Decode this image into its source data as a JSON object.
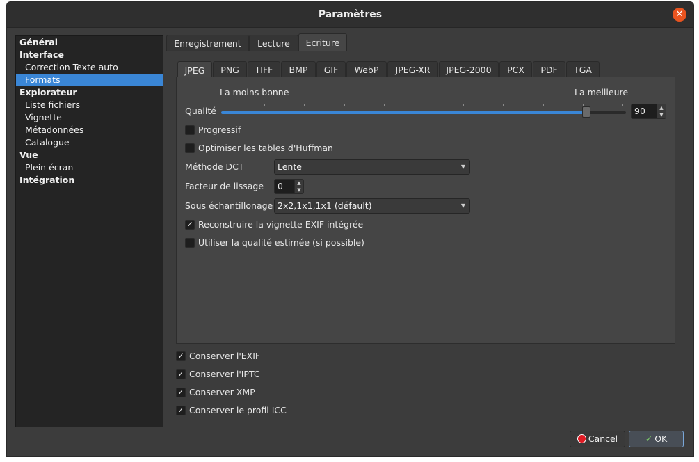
{
  "window": {
    "title": "Paramètres"
  },
  "sidebar": {
    "items": [
      {
        "label": "Général",
        "type": "cat"
      },
      {
        "label": "Interface",
        "type": "cat"
      },
      {
        "label": "Correction Texte auto",
        "type": "sub"
      },
      {
        "label": "Formats",
        "type": "sub",
        "selected": true
      },
      {
        "label": "Explorateur",
        "type": "cat"
      },
      {
        "label": "Liste fichiers",
        "type": "sub"
      },
      {
        "label": "Vignette",
        "type": "sub"
      },
      {
        "label": "Métadonnées",
        "type": "sub"
      },
      {
        "label": "Catalogue",
        "type": "sub"
      },
      {
        "label": "Vue",
        "type": "cat"
      },
      {
        "label": "Plein écran",
        "type": "sub"
      },
      {
        "label": "Intégration",
        "type": "cat"
      }
    ]
  },
  "tabs_top": [
    {
      "label": "Enregistrement"
    },
    {
      "label": "Lecture"
    },
    {
      "label": "Ecriture",
      "active": true
    }
  ],
  "tabs_format": [
    {
      "label": "JPEG",
      "active": true
    },
    {
      "label": "PNG"
    },
    {
      "label": "TIFF"
    },
    {
      "label": "BMP"
    },
    {
      "label": "GIF"
    },
    {
      "label": "WebP"
    },
    {
      "label": "JPEG-XR"
    },
    {
      "label": "JPEG-2000"
    },
    {
      "label": "PCX"
    },
    {
      "label": "PDF"
    },
    {
      "label": "TGA"
    }
  ],
  "jpeg": {
    "quality_min_label": "La moins bonne",
    "quality_max_label": "La meilleure",
    "quality_label": "Qualité",
    "quality_value": "90",
    "quality_slider_fraction": 0.9,
    "progressive_label": "Progressif",
    "progressive_checked": false,
    "huffman_label": "Optimiser les tables d'Huffman",
    "huffman_checked": false,
    "dct_label": "Méthode DCT",
    "dct_value": "Lente",
    "smoothing_label": "Facteur de lissage",
    "smoothing_value": "0",
    "subsampling_label": "Sous échantillonage",
    "subsampling_value": "2x2,1x1,1x1 (défault)",
    "exif_thumb_label": "Reconstruire la vignette EXIF intégrée",
    "exif_thumb_checked": true,
    "estimated_quality_label": "Utiliser la qualité estimée (si possible)",
    "estimated_quality_checked": false
  },
  "keep": {
    "exif_label": "Conserver l'EXIF",
    "iptc_label": "Conserver l'IPTC",
    "xmp_label": "Conserver XMP",
    "icc_label": "Conserver le profil ICC"
  },
  "buttons": {
    "cancel_label": "Cancel",
    "ok_label": "OK"
  },
  "check_glyph": "✓"
}
